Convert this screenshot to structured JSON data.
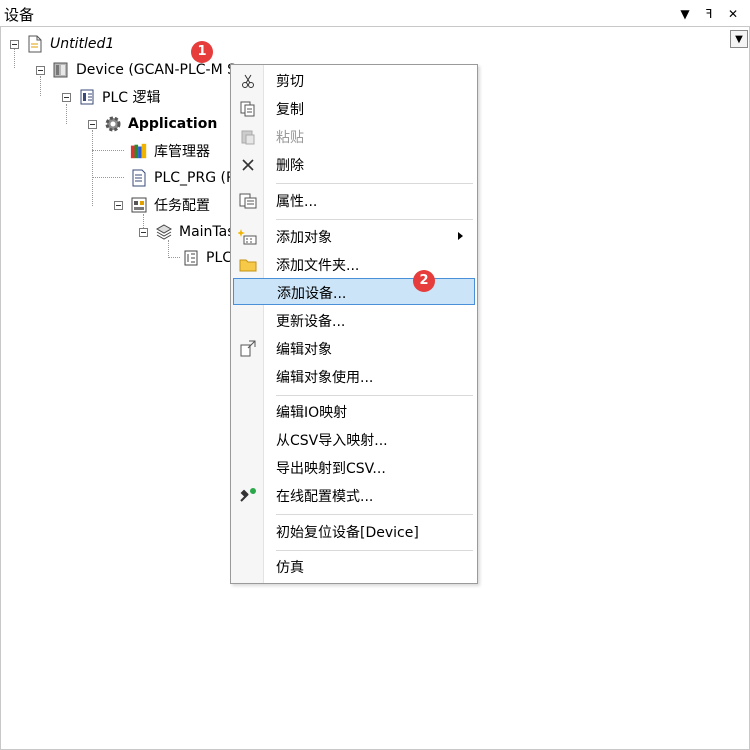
{
  "window": {
    "title": "设备",
    "btn_dropdown": "▼",
    "btn_pin": "ꟻ",
    "btn_close": "✕"
  },
  "tree": {
    "project": "Untitled1",
    "device": "Device (GCAN-PLC-M Se",
    "plc_logic": "PLC 逻辑",
    "application": "Application",
    "library_manager": "库管理器",
    "plc_prg": "PLC_PRG (P",
    "task_config": "任务配置",
    "main_task": "MainTas",
    "plc_short": "PLC"
  },
  "menu": {
    "items": [
      {
        "label": "剪切",
        "icon": "scissors-icon"
      },
      {
        "label": "复制",
        "icon": "copy-icon"
      },
      {
        "label": "粘贴",
        "icon": "paste-icon",
        "disabled": true
      },
      {
        "label": "删除",
        "icon": "delete-icon"
      },
      {
        "label": "属性...",
        "icon": "properties-icon"
      },
      {
        "label": "添加对象",
        "icon": "add-object-icon",
        "submenu": true
      },
      {
        "label": "添加文件夹...",
        "icon": "folder-icon"
      },
      {
        "label": "添加设备...",
        "icon": "",
        "highlighted": true
      },
      {
        "label": "更新设备...",
        "icon": ""
      },
      {
        "label": "编辑对象",
        "icon": "edit-object-icon"
      },
      {
        "label": "编辑对象使用...",
        "icon": ""
      },
      {
        "label": "编辑IO映射",
        "icon": ""
      },
      {
        "label": "从CSV导入映射...",
        "icon": ""
      },
      {
        "label": "导出映射到CSV...",
        "icon": ""
      },
      {
        "label": "在线配置模式...",
        "icon": "online-config-icon"
      },
      {
        "label": "初始复位设备[Device]",
        "icon": ""
      },
      {
        "label": "仿真",
        "icon": ""
      }
    ]
  },
  "badges": {
    "one": "1",
    "two": "2"
  },
  "colors": {
    "highlight_bg": "#cce4f7",
    "highlight_border": "#4a90d9",
    "badge": "#e63c3c"
  }
}
